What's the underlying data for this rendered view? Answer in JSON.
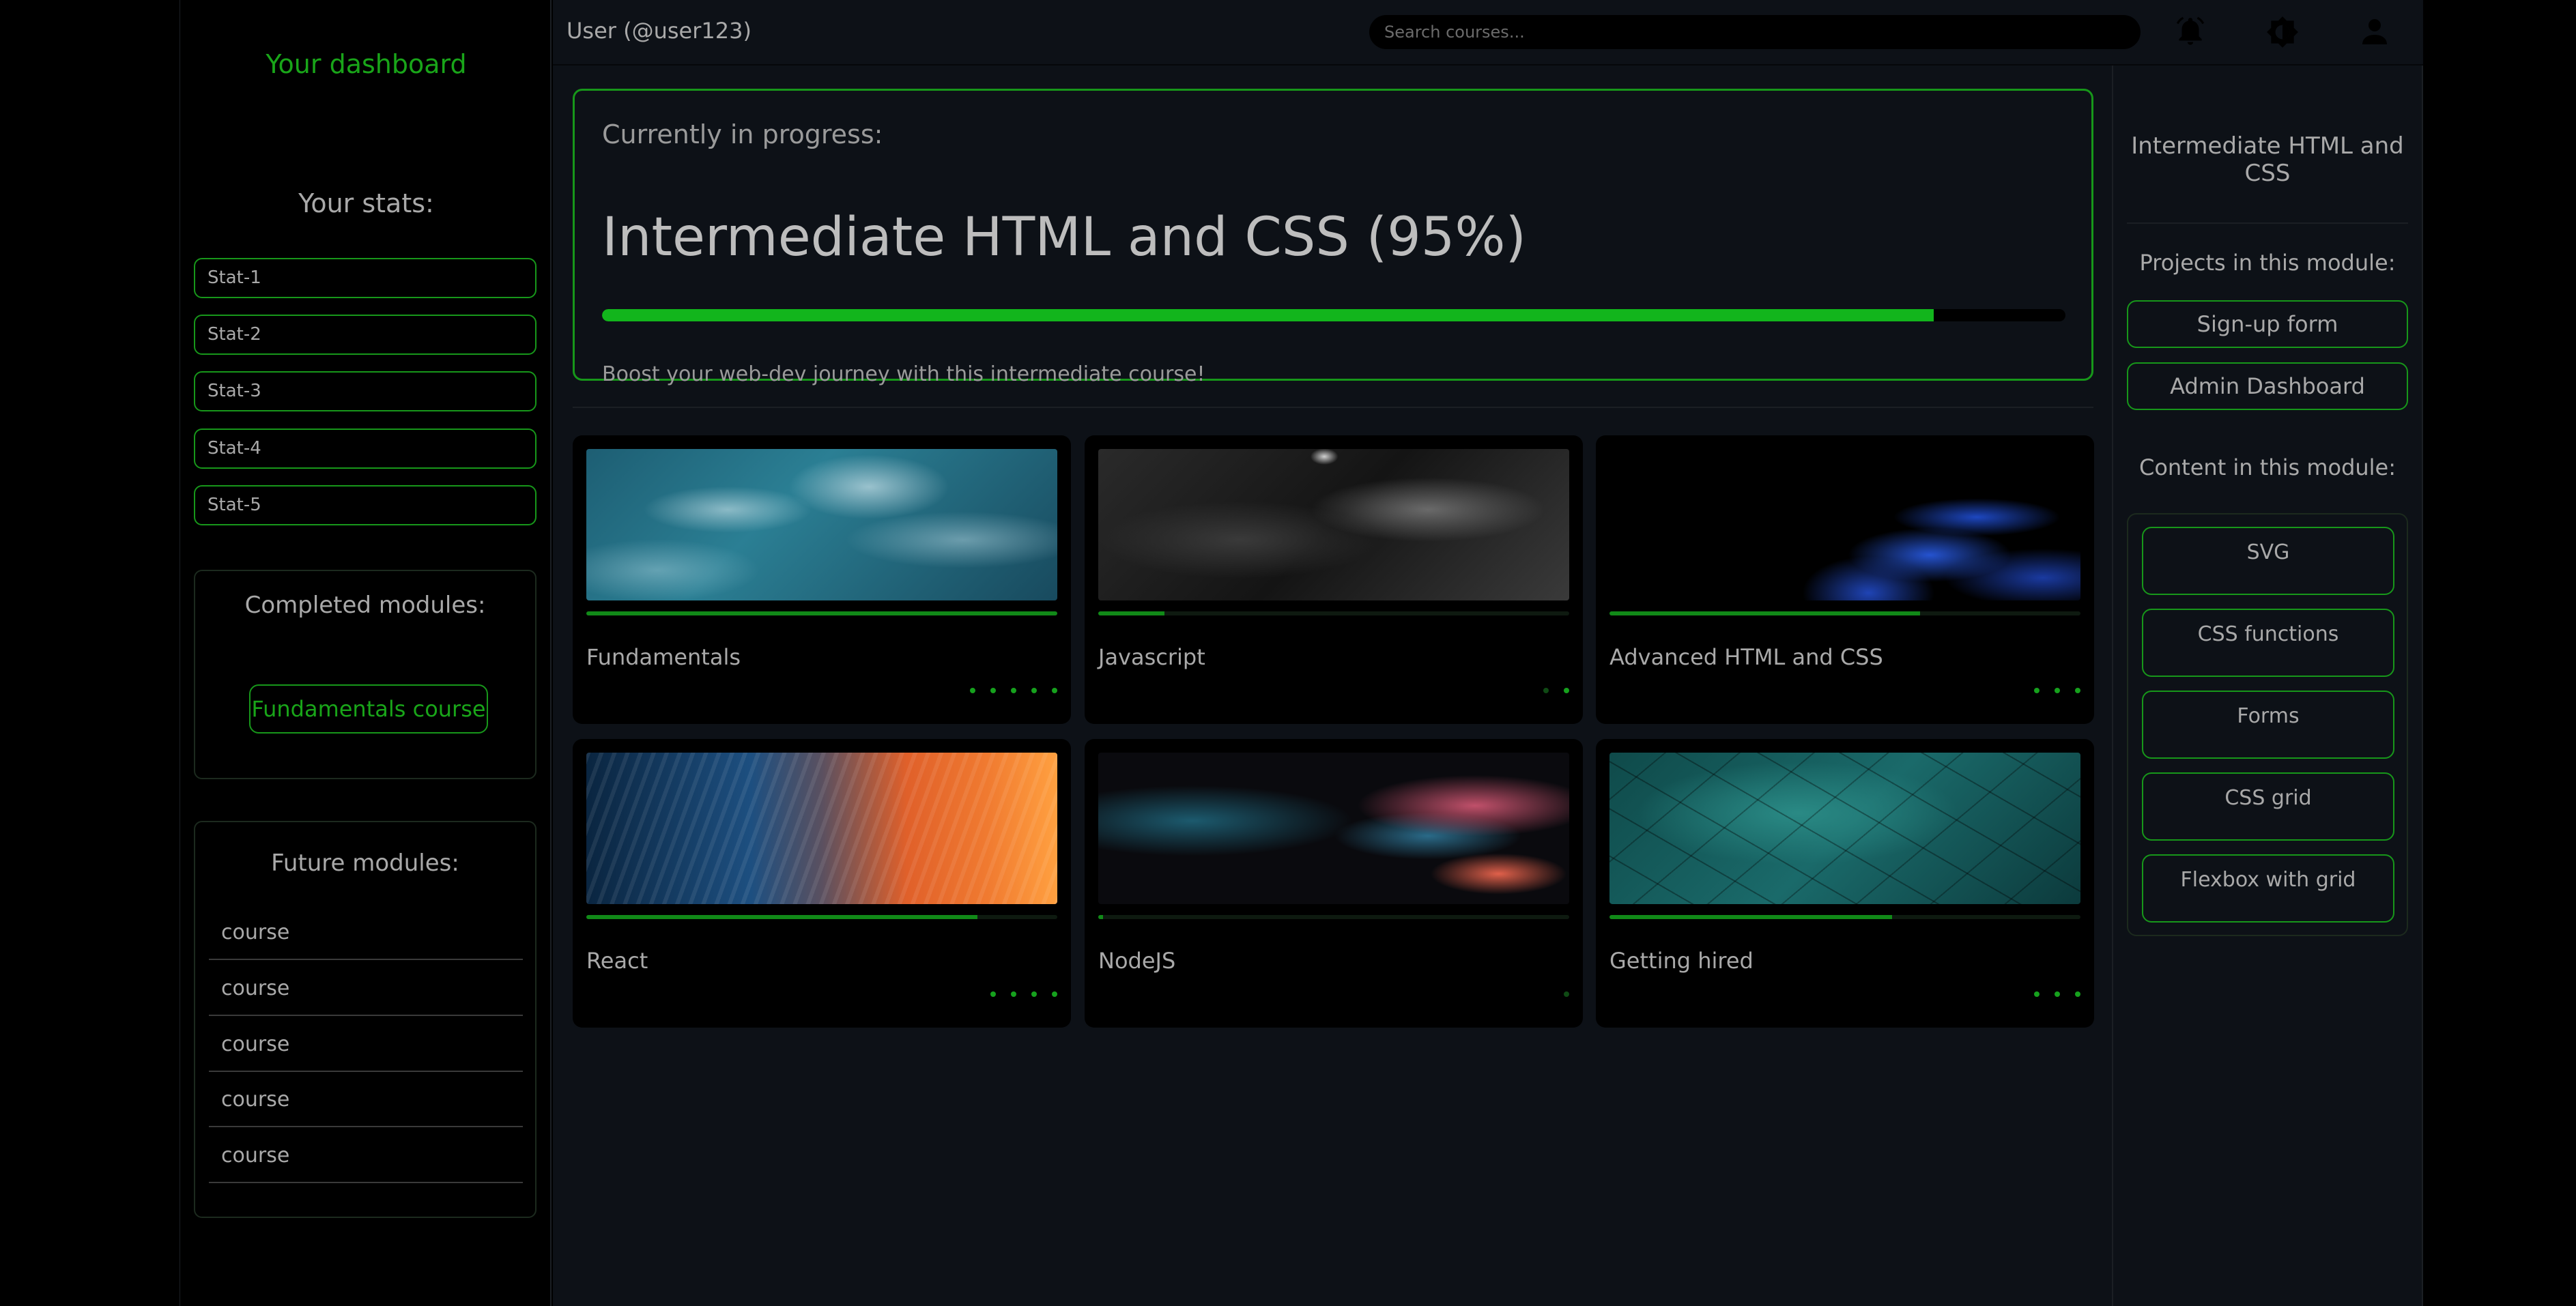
{
  "sidebar": {
    "title": "Your dashboard",
    "stats_title": "Your stats:",
    "stats": [
      "Stat-1",
      "Stat-2",
      "Stat-3",
      "Stat-4",
      "Stat-5"
    ],
    "completed_title": "Completed modules:",
    "completed": [
      "Fundamentals course"
    ],
    "future_title": "Future modules:",
    "future": [
      "course",
      "course",
      "course",
      "course",
      "course"
    ]
  },
  "header": {
    "user": "User (@user123)",
    "search_placeholder": "Search courses...",
    "icons": [
      "bell-icon",
      "theme-toggle-icon",
      "profile-icon"
    ]
  },
  "current": {
    "label": "Currently in progress:",
    "title": "Intermediate HTML and CSS (95%)",
    "progress": 0.91,
    "description": "Boost your web-dev journey with this intermediate course!"
  },
  "courses": [
    {
      "title": "Fundamentals",
      "progress": 1.0,
      "dots": 5,
      "active_dots": 5,
      "image": "ocean-waves"
    },
    {
      "title": "Javascript",
      "progress": 0.14,
      "dots": 2,
      "active_dots": 1,
      "image": "dark-rock"
    },
    {
      "title": "Advanced HTML and CSS",
      "progress": 0.66,
      "dots": 3,
      "active_dots": 3,
      "image": "blue-feathers"
    },
    {
      "title": "React",
      "progress": 0.83,
      "dots": 4,
      "active_dots": 4,
      "image": "orange-blue-streaks"
    },
    {
      "title": "NodeJS",
      "progress": 0.01,
      "dots": 1,
      "active_dots": 0,
      "image": "smoke-red-blue"
    },
    {
      "title": "Getting hired",
      "progress": 0.6,
      "dots": 3,
      "active_dots": 3,
      "image": "teal-leaf"
    }
  ],
  "right": {
    "module_title": "Intermediate HTML and CSS",
    "projects_title": "Projects in this module:",
    "projects": [
      "Sign-up form",
      "Admin Dashboard"
    ],
    "content_title": "Content in this module:",
    "content": [
      "SVG",
      "CSS functions",
      "Forms",
      "CSS grid",
      "Flexbox with grid"
    ]
  },
  "colors": {
    "accent": "#17971a",
    "background": "#000000",
    "panel": "#0d1117"
  }
}
